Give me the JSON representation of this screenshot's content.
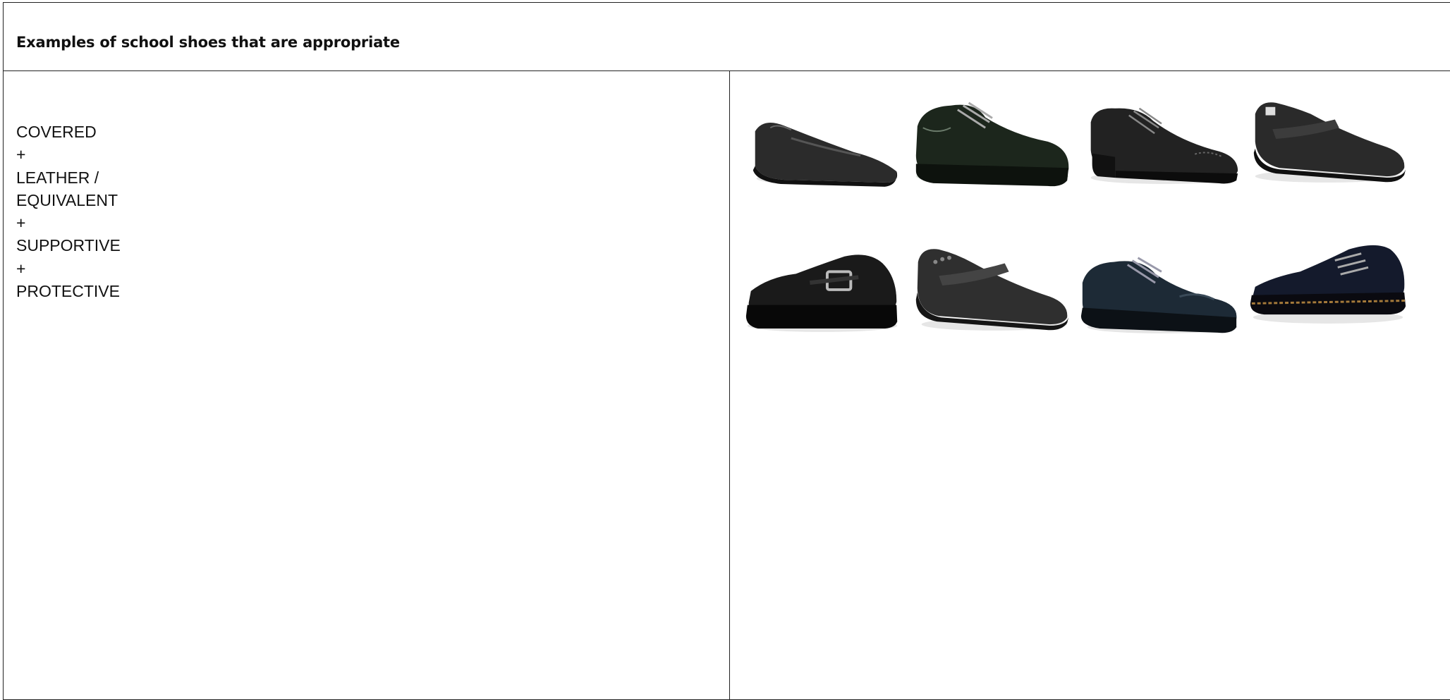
{
  "table": {
    "header": "Examples of school shoes that are appropriate",
    "criteria": [
      "COVERED",
      "+",
      "LEATHER /",
      "EQUIVALENT",
      "+",
      "SUPPORTIVE",
      "+",
      "PROTECTIVE"
    ]
  },
  "shoes": [
    {
      "icon": "loafer-shoe-icon"
    },
    {
      "icon": "lace-up-shoe-icon"
    },
    {
      "icon": "brogue-shoe-icon"
    },
    {
      "icon": "strap-shoe-icon"
    },
    {
      "icon": "buckle-shoe-icon"
    },
    {
      "icon": "mary-jane-shoe-icon"
    },
    {
      "icon": "derby-shoe-icon"
    },
    {
      "icon": "boot-shoe-icon"
    }
  ]
}
